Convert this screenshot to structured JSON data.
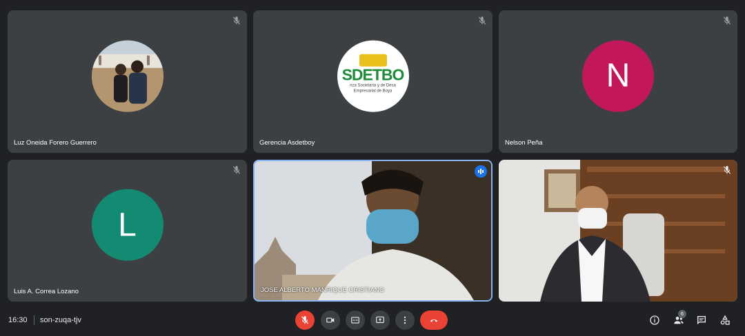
{
  "tiles": [
    {
      "name": "Luz Oneida Forero Guerrero",
      "avatar_type": "photo",
      "mic": "mic-off-icon"
    },
    {
      "name": "Gerencia Asdetboy",
      "avatar_type": "logo",
      "logo_text": "SDETBO",
      "logo_sub_1": "nza Societaria y de Desa",
      "logo_sub_2": "Empresarial de Boya",
      "mic": "mic-off-icon"
    },
    {
      "name": "Nelson Peña",
      "avatar_type": "letter",
      "letter": "N",
      "color": "#c2185b",
      "mic": "mic-off-icon"
    },
    {
      "name": "Luis A. Correa Lozano",
      "avatar_type": "letter",
      "letter": "L",
      "color": "#138a72",
      "mic": "mic-off-icon"
    },
    {
      "name": "JOSE ALBERTO MANRIQUE CRISTIANO",
      "avatar_type": "video",
      "speaking": true
    },
    {
      "name": "",
      "avatar_type": "video",
      "mic": "mic-off-icon"
    }
  ],
  "bottom_bar": {
    "time": "16:30",
    "meeting_code": "son-zuqa-tjv",
    "participants_count": "6"
  },
  "colors": {
    "background": "#202124",
    "tile": "#3c4043",
    "danger": "#ea4335",
    "accent": "#8ab4f8"
  }
}
